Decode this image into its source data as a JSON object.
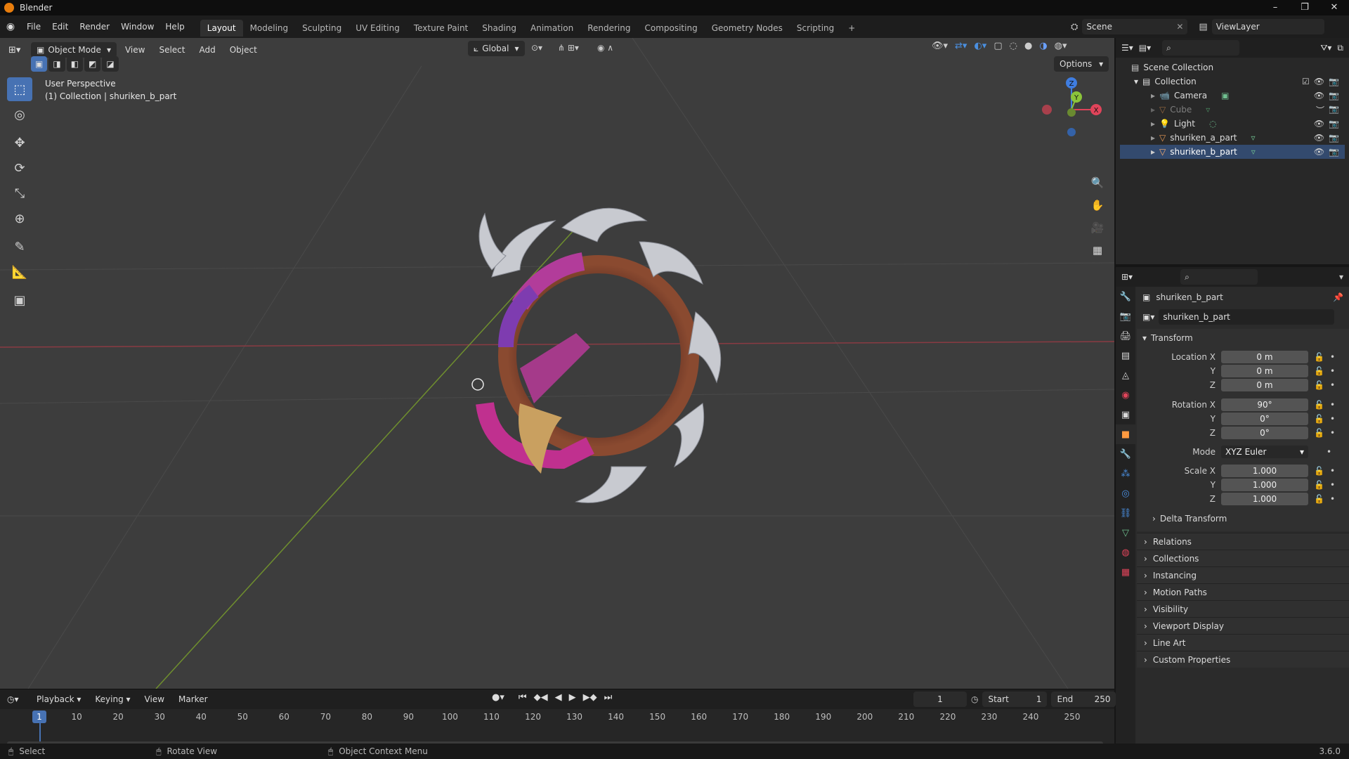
{
  "window": {
    "title": "Blender",
    "controls": [
      "–",
      "❐",
      "✕"
    ]
  },
  "menu": {
    "items": [
      "File",
      "Edit",
      "Render",
      "Window",
      "Help"
    ],
    "workspaces": [
      "Layout",
      "Modeling",
      "Sculpting",
      "UV Editing",
      "Texture Paint",
      "Shading",
      "Animation",
      "Rendering",
      "Compositing",
      "Geometry Nodes",
      "Scripting"
    ],
    "add_tab": "+",
    "scene": "Scene",
    "view_layer": "ViewLayer"
  },
  "viewport": {
    "mode": "Object Mode",
    "menus": [
      "View",
      "Select",
      "Add",
      "Object"
    ],
    "transform_orientation": "Global",
    "options": "Options",
    "info_line1": "User Perspective",
    "info_line2": "(1) Collection | shuriken_b_part",
    "gizmo": {
      "z": "Z",
      "y": "Y",
      "x": "X"
    }
  },
  "tools": [
    {
      "name": "select-box-tool",
      "glyph": "⬚"
    },
    {
      "name": "cursor-tool",
      "glyph": "◎"
    },
    {
      "name": "move-tool",
      "glyph": "✥"
    },
    {
      "name": "rotate-tool",
      "glyph": "⟳"
    },
    {
      "name": "scale-tool",
      "glyph": "⤡"
    },
    {
      "name": "transform-tool",
      "glyph": "⊕"
    },
    {
      "name": "annotate-tool",
      "glyph": "✎"
    },
    {
      "name": "measure-tool",
      "glyph": "📐"
    },
    {
      "name": "add-cube-tool",
      "glyph": "▣"
    }
  ],
  "nav_tools": [
    {
      "name": "zoom-icon",
      "glyph": "🔍"
    },
    {
      "name": "hand-pan-icon",
      "glyph": "✋"
    },
    {
      "name": "camera-view-icon",
      "glyph": "🎥"
    },
    {
      "name": "grid-perspective-icon",
      "glyph": "▦"
    }
  ],
  "outliner": {
    "root": "Scene Collection",
    "collection": "Collection",
    "items": [
      {
        "label": "Camera",
        "dim": false,
        "icon_color": "#e89a55"
      },
      {
        "label": "Cube",
        "dim": true,
        "icon_color": "#e89a55"
      },
      {
        "label": "Light",
        "dim": false,
        "icon_color": "#e89a55"
      },
      {
        "label": "shuriken_a_part",
        "dim": false,
        "icon_color": "#e89a55"
      },
      {
        "label": "shuriken_b_part",
        "dim": false,
        "icon_color": "#e89a55"
      }
    ]
  },
  "properties": {
    "object_name": "shuriken_b_part",
    "data_name": "shuriken_b_part",
    "transform_label": "Transform",
    "location": {
      "label": "Location X",
      "x": "0 m",
      "y": "0 m",
      "z": "0 m"
    },
    "rotation": {
      "label": "Rotation X",
      "x": "90°",
      "y": "0°",
      "z": "0°"
    },
    "mode_label": "Mode",
    "mode_value": "XYZ Euler",
    "scale": {
      "label": "Scale X",
      "x": "1.000",
      "y": "1.000",
      "z": "1.000"
    },
    "axis_y": "Y",
    "axis_z": "Z",
    "delta": "Delta Transform",
    "subpanels": [
      "Relations",
      "Collections",
      "Instancing",
      "Motion Paths",
      "Visibility",
      "Viewport Display",
      "Line Art",
      "Custom Properties"
    ]
  },
  "timeline": {
    "menus": [
      "Playback",
      "Keying",
      "View",
      "Marker"
    ],
    "current_frame": "1",
    "start_label": "Start",
    "start": "1",
    "end_label": "End",
    "end": "250",
    "ruler": [
      "1",
      "10",
      "20",
      "30",
      "40",
      "50",
      "60",
      "70",
      "80",
      "90",
      "100",
      "110",
      "120",
      "130",
      "140",
      "150",
      "160",
      "170",
      "180",
      "190",
      "200",
      "210",
      "220",
      "230",
      "240",
      "250"
    ]
  },
  "status": {
    "select": "Select",
    "rotate": "Rotate View",
    "context": "Object Context Menu",
    "version": "3.6.0"
  },
  "colors": {
    "accent": "#4772b3",
    "active_frame": "#4772b3",
    "x_axis": "#e0445a",
    "y_axis": "#8bc43a",
    "z_axis": "#3f7de0"
  }
}
